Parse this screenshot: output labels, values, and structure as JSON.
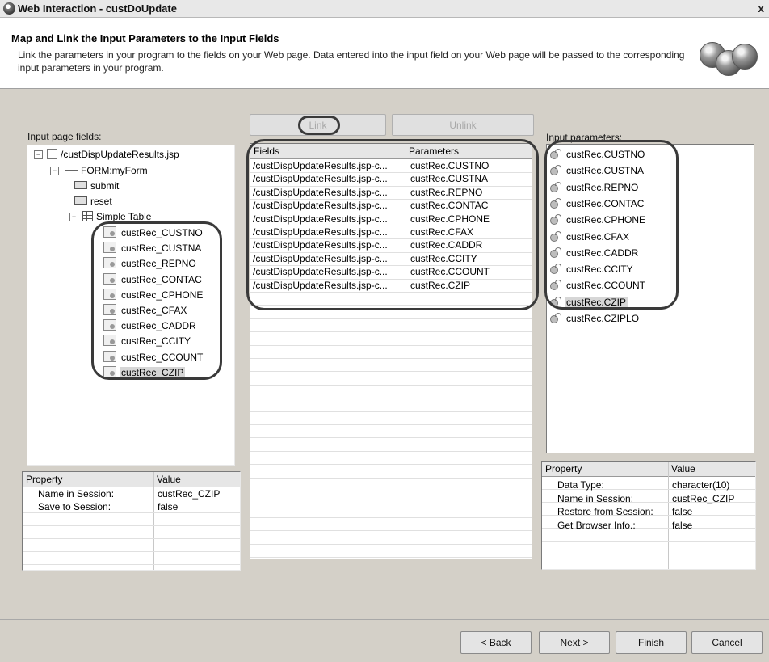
{
  "window": {
    "title": "Web Interaction - custDoUpdate",
    "close_glyph": "x"
  },
  "banner": {
    "heading": "Map and Link the Input Parameters to the Input Fields",
    "description": "Link the parameters in your program to the fields on your Web page. Data entered into the input field on your Web page will be passed to the corresponding input parameters in your program."
  },
  "left": {
    "label": "Input page fields:",
    "tree": {
      "root": "/custDispUpdateResults.jsp",
      "form": "FORM:myForm",
      "submit": "submit",
      "reset": "reset",
      "table": "Simple Table",
      "fields": [
        "custRec_CUSTNO",
        "custRec_CUSTNA",
        "custRec_REPNO",
        "custRec_CONTAC",
        "custRec_CPHONE",
        "custRec_CFAX",
        "custRec_CADDR",
        "custRec_CCITY",
        "custRec_CCOUNT",
        "custRec_CZIP"
      ],
      "selected": "custRec_CZIP"
    },
    "props": {
      "headers": [
        "Property",
        "Value"
      ],
      "rows": [
        {
          "property": "Name in Session:",
          "value": "custRec_CZIP"
        },
        {
          "property": "Save to Session:",
          "value": "false"
        }
      ]
    }
  },
  "middle": {
    "link_label": "Link",
    "unlink_label": "Unlink",
    "headers": [
      "Fields",
      "Parameters"
    ],
    "rows": [
      {
        "field": "/custDispUpdateResults.jsp-c...",
        "param": "custRec.CUSTNO"
      },
      {
        "field": "/custDispUpdateResults.jsp-c...",
        "param": "custRec.CUSTNA"
      },
      {
        "field": "/custDispUpdateResults.jsp-c...",
        "param": "custRec.REPNO"
      },
      {
        "field": "/custDispUpdateResults.jsp-c...",
        "param": "custRec.CONTAC"
      },
      {
        "field": "/custDispUpdateResults.jsp-c...",
        "param": "custRec.CPHONE"
      },
      {
        "field": "/custDispUpdateResults.jsp-c...",
        "param": "custRec.CFAX"
      },
      {
        "field": "/custDispUpdateResults.jsp-c...",
        "param": "custRec.CADDR"
      },
      {
        "field": "/custDispUpdateResults.jsp-c...",
        "param": "custRec.CCITY"
      },
      {
        "field": "/custDispUpdateResults.jsp-c...",
        "param": "custRec.CCOUNT"
      },
      {
        "field": "/custDispUpdateResults.jsp-c...",
        "param": "custRec.CZIP"
      }
    ]
  },
  "right": {
    "label": "Input parameters:",
    "params": [
      "custRec.CUSTNO",
      "custRec.CUSTNA",
      "custRec.REPNO",
      "custRec.CONTAC",
      "custRec.CPHONE",
      "custRec.CFAX",
      "custRec.CADDR",
      "custRec.CCITY",
      "custRec.CCOUNT",
      "custRec.CZIP",
      "custRec.CZIPLO"
    ],
    "selected": "custRec.CZIP",
    "props": {
      "headers": [
        "Property",
        "Value"
      ],
      "rows": [
        {
          "property": "Data Type:",
          "value": "character(10)"
        },
        {
          "property": "Name in Session:",
          "value": "custRec_CZIP"
        },
        {
          "property": "Restore from Session:",
          "value": "false"
        },
        {
          "property": "Get Browser Info.:",
          "value": "false"
        }
      ]
    }
  },
  "footer": {
    "back": "< Back",
    "next": "Next >",
    "finish": "Finish",
    "cancel": "Cancel"
  }
}
